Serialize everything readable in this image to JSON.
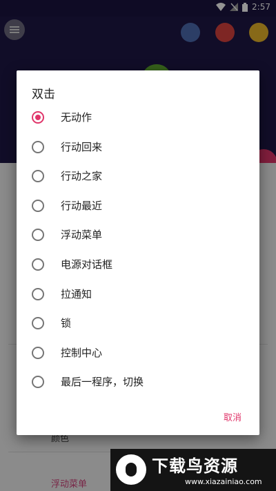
{
  "status_bar": {
    "time": "2:57"
  },
  "background": {
    "card_label": "颜色",
    "bottom_link": "浮动菜单"
  },
  "dialog": {
    "title": "双击",
    "selected_index": 0,
    "options": [
      "无动作",
      "行动回来",
      "行动之家",
      "行动最近",
      "浮动菜单",
      "电源对话框",
      "拉通知",
      "锁",
      "控制中心",
      "最后一程序，切换"
    ],
    "cancel_label": "取消"
  },
  "watermark": {
    "title": "下载鸟资源",
    "url": "www.xiazainiao.com"
  },
  "colors": {
    "accent": "#e0356a",
    "header": "#1e1746"
  }
}
